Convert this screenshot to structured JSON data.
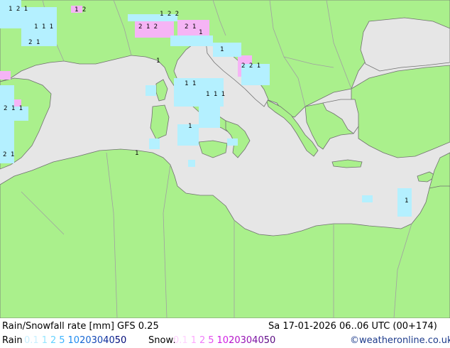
{
  "header": {
    "title": "Rain/Snowfall rate [mm] GFS 0.25",
    "datetime": "Sa 17-01-2026 06..06 UTC (00+174)"
  },
  "legend": {
    "rain_label": "Rain",
    "rain_values": [
      "0.1",
      "1",
      "2",
      "5",
      "10",
      "20",
      "30",
      "40",
      "50"
    ],
    "rain_colors": [
      "#c8f0ff",
      "#96e6ff",
      "#64d2ff",
      "#3cb4ff",
      "#1e8cf0",
      "#1464d2",
      "#1446b4",
      "#0a2896",
      "#000a78"
    ],
    "snow_label": "Snow:",
    "snow_values": [
      "0.1",
      "1",
      "2",
      "5",
      "10",
      "20",
      "30",
      "40",
      "50"
    ],
    "snow_colors": [
      "#ffd2ff",
      "#ffaaff",
      "#f07dfa",
      "#e650f0",
      "#d21ee6",
      "#b414c8",
      "#9614b4",
      "#7814a0",
      "#5a0a82"
    ],
    "credit": "©weatheronline.co.uk"
  },
  "map": {
    "land_color": "#aaf08c",
    "sea_color": "#e6e6e6",
    "border_color": "#a0a0a0",
    "coast_color": "#707070",
    "rain_color": "#b4f0ff",
    "snow_color": "#f5b4f5"
  }
}
